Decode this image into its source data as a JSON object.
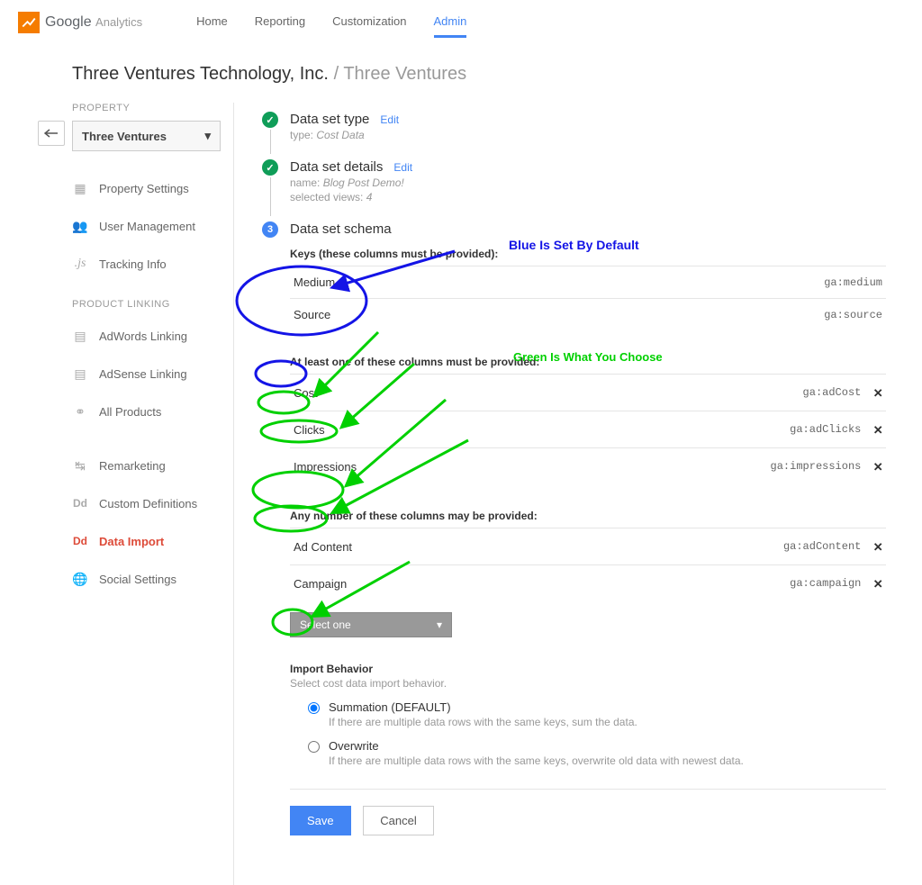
{
  "header": {
    "logo_text": "Google",
    "logo_sub": "Analytics",
    "nav": [
      "Home",
      "Reporting",
      "Customization",
      "Admin"
    ],
    "active_nav": "Admin"
  },
  "breadcrumb": {
    "main": "Three Ventures Technology, Inc.",
    "sub": "Three Ventures"
  },
  "sidebar": {
    "property_label": "PROPERTY",
    "property_selected": "Three Ventures",
    "items_top": [
      {
        "icon": "grid",
        "label": "Property Settings"
      },
      {
        "icon": "people",
        "label": "User Management"
      },
      {
        "icon": "js",
        "label": "Tracking Info"
      }
    ],
    "product_linking_label": "PRODUCT LINKING",
    "items_linking": [
      {
        "icon": "adwords",
        "label": "AdWords Linking"
      },
      {
        "icon": "adsense",
        "label": "AdSense Linking"
      },
      {
        "icon": "link",
        "label": "All Products"
      }
    ],
    "items_bottom": [
      {
        "icon": "remarketing",
        "label": "Remarketing"
      },
      {
        "icon": "dd",
        "label": "Custom Definitions"
      },
      {
        "icon": "dd",
        "label": "Data Import",
        "active": true
      },
      {
        "icon": "globe",
        "label": "Social Settings"
      }
    ]
  },
  "steps": {
    "type": {
      "title": "Data set type",
      "edit": "Edit",
      "meta_label": "type:",
      "meta_value": "Cost Data"
    },
    "details": {
      "title": "Data set details",
      "edit": "Edit",
      "name_label": "name:",
      "name_value": "Blog Post Demo!",
      "views_label": "selected views:",
      "views_value": "4"
    },
    "schema": {
      "number": "3",
      "title": "Data set schema",
      "keys_heading": "Keys (these columns must be provided):",
      "keys": [
        {
          "label": "Medium",
          "code": "ga:medium"
        },
        {
          "label": "Source",
          "code": "ga:source"
        }
      ],
      "atleast_heading": "At least one of these columns must be provided:",
      "atleast": [
        {
          "label": "Cost",
          "code": "ga:adCost"
        },
        {
          "label": "Clicks",
          "code": "ga:adClicks"
        },
        {
          "label": "Impressions",
          "code": "ga:impressions"
        }
      ],
      "any_heading": "Any number of these columns may be provided:",
      "any": [
        {
          "label": "Ad Content",
          "code": "ga:adContent"
        },
        {
          "label": "Campaign",
          "code": "ga:campaign"
        }
      ],
      "select_placeholder": "Select one",
      "import_title": "Import Behavior",
      "import_desc": "Select cost data import behavior.",
      "radio_summation": "Summation (DEFAULT)",
      "radio_summation_hint": "If there are multiple data rows with the same keys, sum the data.",
      "radio_overwrite": "Overwrite",
      "radio_overwrite_hint": "If there are multiple data rows with the same keys, overwrite old data with newest data."
    }
  },
  "buttons": {
    "save": "Save",
    "cancel": "Cancel"
  },
  "annotations": {
    "blue": "Blue Is Set By Default",
    "green": "Green Is What You Choose"
  }
}
